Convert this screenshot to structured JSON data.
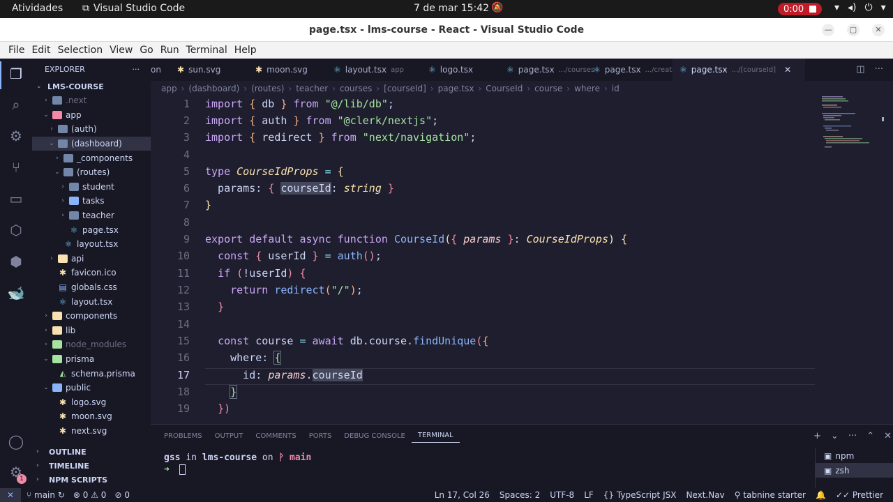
{
  "os": {
    "activities": "Atividades",
    "app": "Visual Studio Code",
    "clock": "7 de mar  15:42",
    "recording": "0:00"
  },
  "window": {
    "title": "page.tsx - lms-course - React - Visual Studio Code"
  },
  "menu": [
    "File",
    "Edit",
    "Selection",
    "View",
    "Go",
    "Run",
    "Terminal",
    "Help"
  ],
  "sidebar": {
    "title": "EXPLORER",
    "root": "LMS-COURSE",
    "items": [
      {
        "label": ".next",
        "depth": 1,
        "kind": "folder",
        "dim": true
      },
      {
        "label": "app",
        "depth": 1,
        "kind": "folder-app",
        "open": true
      },
      {
        "label": "(auth)",
        "depth": 2,
        "kind": "folder"
      },
      {
        "label": "(dashboard)",
        "depth": 2,
        "kind": "folder",
        "open": true,
        "selected": true
      },
      {
        "label": "_components",
        "depth": 3,
        "kind": "folder"
      },
      {
        "label": "(routes)",
        "depth": 3,
        "kind": "folder",
        "open": true
      },
      {
        "label": "student",
        "depth": 4,
        "kind": "folder"
      },
      {
        "label": "tasks",
        "depth": 4,
        "kind": "folder-blue"
      },
      {
        "label": "teacher",
        "depth": 4,
        "kind": "folder"
      },
      {
        "label": "page.tsx",
        "depth": 4,
        "kind": "react",
        "file": true
      },
      {
        "label": "layout.tsx",
        "depth": 3,
        "kind": "react",
        "file": true
      },
      {
        "label": "api",
        "depth": 2,
        "kind": "folder-yellow"
      },
      {
        "label": "favicon.ico",
        "depth": 2,
        "kind": "star",
        "file": true
      },
      {
        "label": "globals.css",
        "depth": 2,
        "kind": "css",
        "file": true
      },
      {
        "label": "layout.tsx",
        "depth": 2,
        "kind": "react",
        "file": true
      },
      {
        "label": "components",
        "depth": 1,
        "kind": "folder-yellow"
      },
      {
        "label": "lib",
        "depth": 1,
        "kind": "folder-yellow"
      },
      {
        "label": "node_modules",
        "depth": 1,
        "kind": "folder-green",
        "dim": true
      },
      {
        "label": "prisma",
        "depth": 1,
        "kind": "folder-green",
        "open": true
      },
      {
        "label": "schema.prisma",
        "depth": 2,
        "kind": "prisma",
        "file": true
      },
      {
        "label": "public",
        "depth": 1,
        "kind": "folder-blue",
        "open": true
      },
      {
        "label": "logo.svg",
        "depth": 2,
        "kind": "star",
        "file": true
      },
      {
        "label": "moon.svg",
        "depth": 2,
        "kind": "star",
        "file": true
      },
      {
        "label": "next.svg",
        "depth": 2,
        "kind": "star",
        "file": true
      }
    ],
    "sections": [
      "OUTLINE",
      "TIMELINE",
      "NPM SCRIPTS"
    ]
  },
  "tabs": [
    {
      "label": "on",
      "desc": "",
      "icon": "react"
    },
    {
      "label": "sun.svg",
      "desc": "",
      "icon": "star"
    },
    {
      "label": "moon.svg",
      "desc": "",
      "icon": "star"
    },
    {
      "label": "layout.tsx",
      "desc": "app",
      "icon": "react"
    },
    {
      "label": "logo.tsx",
      "desc": "",
      "icon": "react"
    },
    {
      "label": "page.tsx",
      "desc": ".../courses",
      "icon": "react"
    },
    {
      "label": "page.tsx",
      "desc": ".../create",
      "icon": "react"
    },
    {
      "label": "page.tsx",
      "desc": ".../[courseId]",
      "icon": "react",
      "active": true
    }
  ],
  "breadcrumb": [
    "app",
    "(dashboard)",
    "(routes)",
    "teacher",
    "courses",
    "[courseId]",
    "page.tsx",
    "CourseId",
    "course",
    "where",
    "id"
  ],
  "code_lines": [
    "1",
    "2",
    "3",
    "4",
    "5",
    "6",
    "7",
    "8",
    "9",
    "10",
    "11",
    "12",
    "13",
    "14",
    "15",
    "16",
    "17",
    "18",
    "19"
  ],
  "panel": {
    "tabs": [
      "PROBLEMS",
      "OUTPUT",
      "COMMENTS",
      "PORTS",
      "DEBUG CONSOLE",
      "TERMINAL"
    ],
    "prompt_user": "gss",
    "prompt_in": "in",
    "prompt_dir": "lms-course",
    "prompt_on": "on",
    "prompt_branch": "main",
    "terminals": [
      "npm",
      "zsh"
    ]
  },
  "status": {
    "branch": "main",
    "problems": "0",
    "warnings": "0",
    "ports": "0",
    "position": "Ln 17, Col 26",
    "spaces": "Spaces: 2",
    "encoding": "UTF-8",
    "eol": "LF",
    "language": "TypeScript JSX",
    "nav": "Next.Nav",
    "tabnine": "tabnine starter",
    "prettier": "Prettier"
  },
  "colors": {
    "accent": "#89b4fa",
    "background": "#1e1e2e",
    "sidebar": "#181825"
  }
}
